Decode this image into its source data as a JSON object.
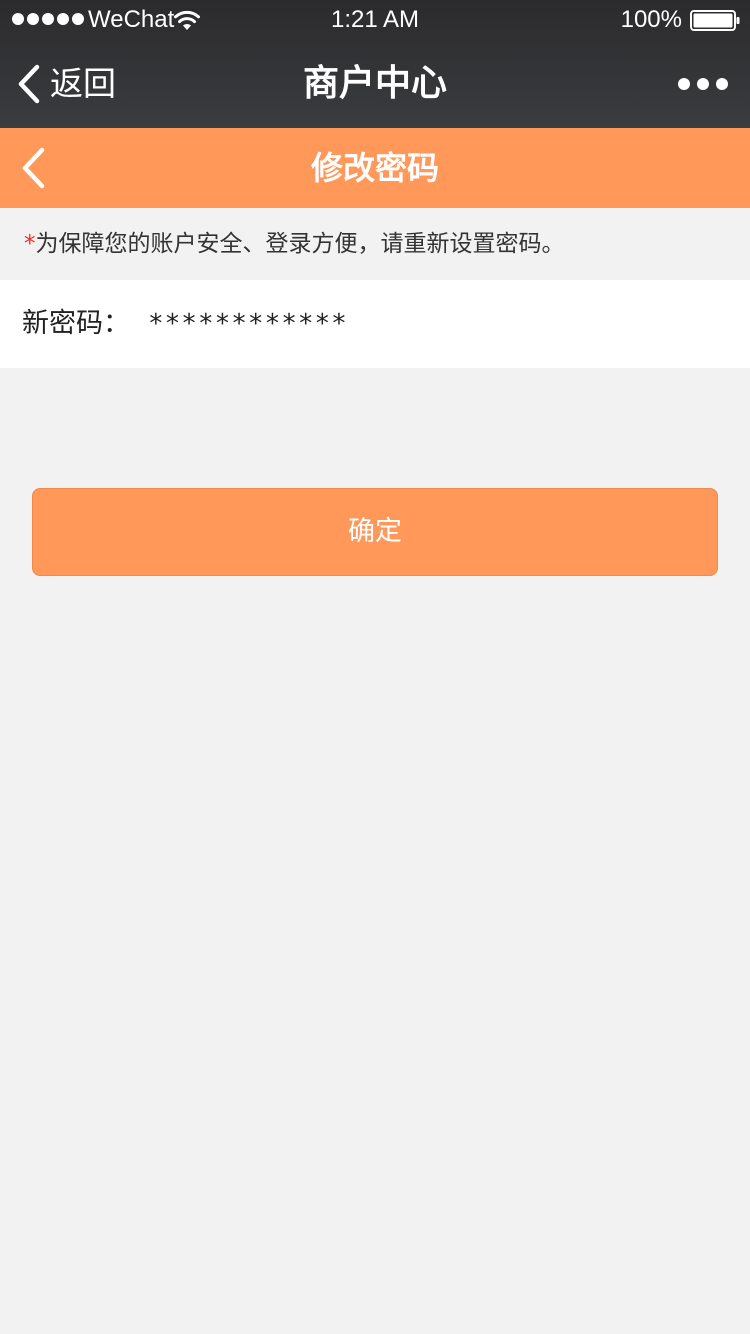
{
  "status_bar": {
    "carrier": "WeChat",
    "time": "1:21 AM",
    "battery_percent": "100%",
    "signal_dots": 5,
    "battery_level": 1.0,
    "icons": [
      "signal-dots",
      "wifi-icon",
      "battery-icon"
    ]
  },
  "wechat_nav": {
    "back_label": "返回",
    "title": "商户中心",
    "icons": [
      "chevron-left-icon",
      "more-dots-icon"
    ]
  },
  "page_header": {
    "title": "修改密码",
    "icons": [
      "chevron-left-icon"
    ]
  },
  "notice": {
    "asterisk": "*",
    "text": "为保障您的账户安全、登录方便，请重新设置密码。"
  },
  "form": {
    "new_password_label": "新密码：",
    "new_password_value": "************"
  },
  "actions": {
    "confirm_label": "确定"
  },
  "colors": {
    "accent": "#ff9858",
    "nav_dark": "#333437",
    "background": "#f3f2f2",
    "required_mark": "#ee2b2b"
  }
}
